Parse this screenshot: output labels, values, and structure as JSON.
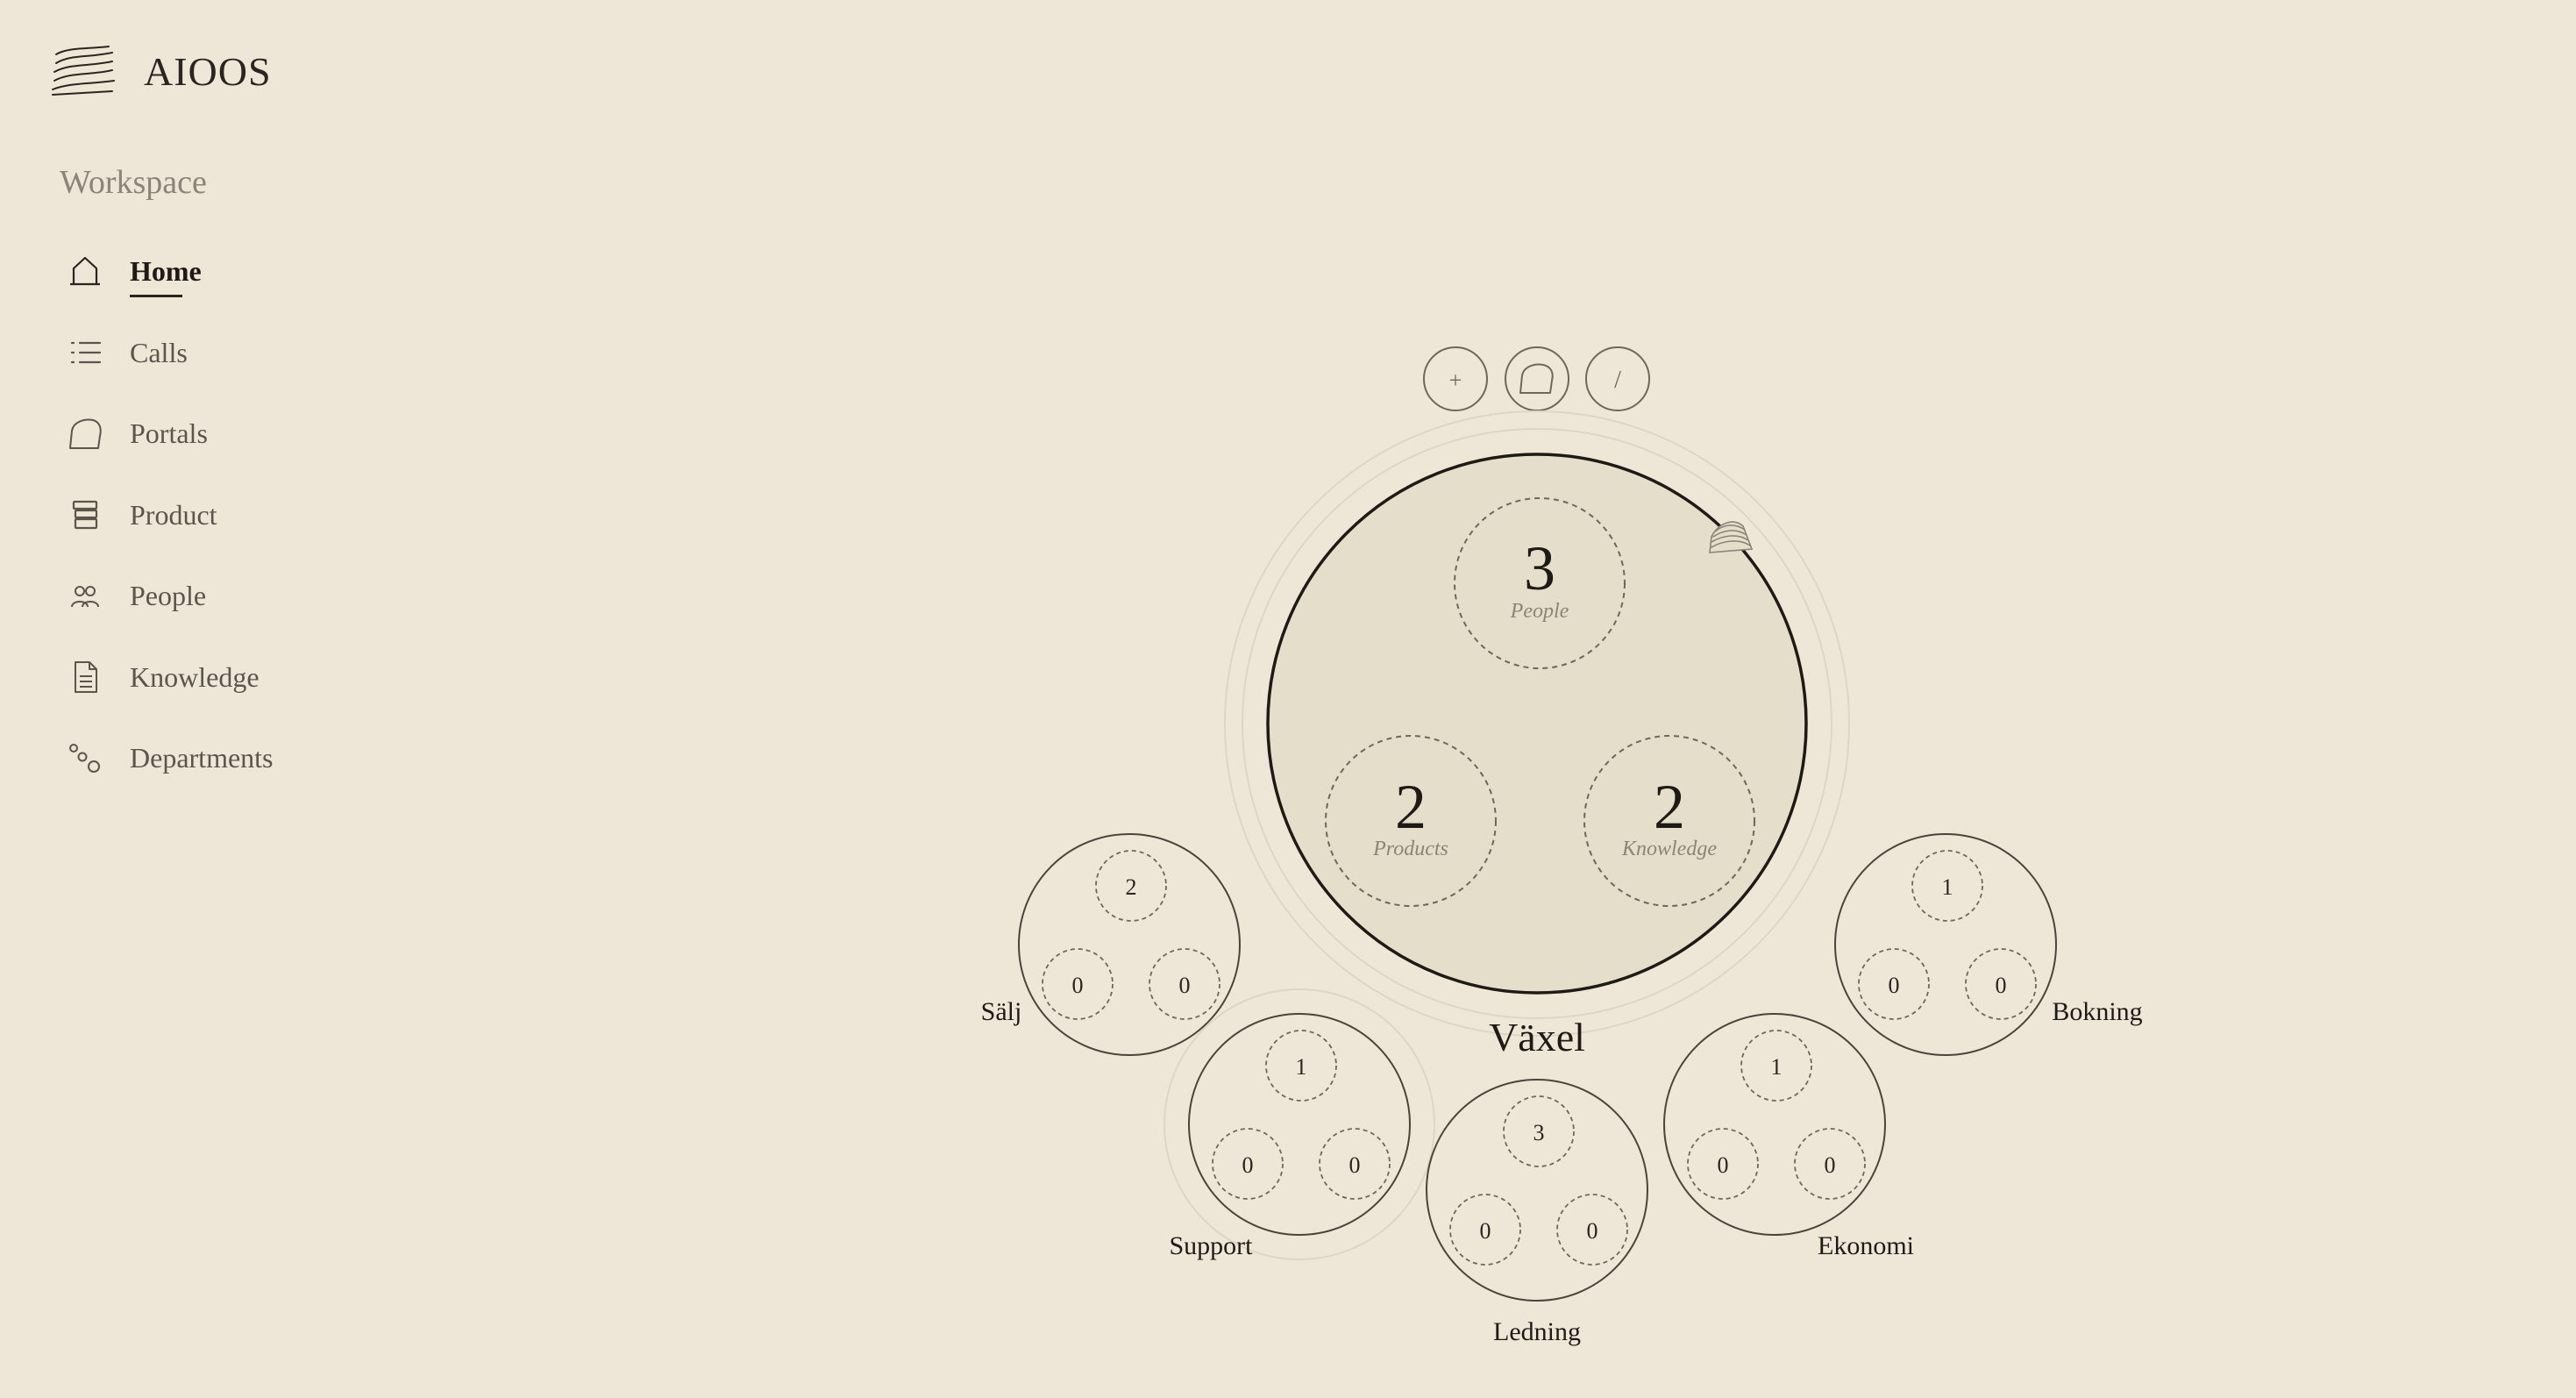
{
  "app": {
    "name": "AIOOS",
    "logo_icon": "layered-waves-icon"
  },
  "sidebar": {
    "section_title": "Workspace",
    "items": [
      {
        "label": "Home",
        "icon": "home-icon",
        "active": true
      },
      {
        "label": "Calls",
        "icon": "list-icon",
        "active": false
      },
      {
        "label": "Portals",
        "icon": "portal-icon",
        "active": false
      },
      {
        "label": "Product",
        "icon": "stack-icon",
        "active": false
      },
      {
        "label": "People",
        "icon": "people-icon",
        "active": false
      },
      {
        "label": "Knowledge",
        "icon": "document-icon",
        "active": false
      },
      {
        "label": "Departments",
        "icon": "departments-icon",
        "active": false
      }
    ]
  },
  "toolbar": {
    "add_label": "+",
    "portal_icon": "portal-icon",
    "edit_label": "/"
  },
  "center": {
    "name": "Växel",
    "stats": [
      {
        "value": "3",
        "label": "People"
      },
      {
        "value": "2",
        "label": "Products"
      },
      {
        "value": "2",
        "label": "Knowledge"
      }
    ],
    "badge_icon": "layered-waves-icon"
  },
  "departments": [
    {
      "name": "Sälj",
      "people": "2",
      "products": "0",
      "knowledge": "0"
    },
    {
      "name": "Support",
      "people": "1",
      "products": "0",
      "knowledge": "0"
    },
    {
      "name": "Ledning",
      "people": "3",
      "products": "0",
      "knowledge": "0"
    },
    {
      "name": "Ekonomi",
      "people": "1",
      "products": "0",
      "knowledge": "0"
    },
    {
      "name": "Bokning",
      "people": "1",
      "products": "0",
      "knowledge": "0"
    }
  ],
  "colors": {
    "background": "#EEE7D8",
    "center_fill": "#E4DECB",
    "ink": "#2A2520",
    "muted": "#8C8478",
    "halo": "#D8D0BE"
  }
}
